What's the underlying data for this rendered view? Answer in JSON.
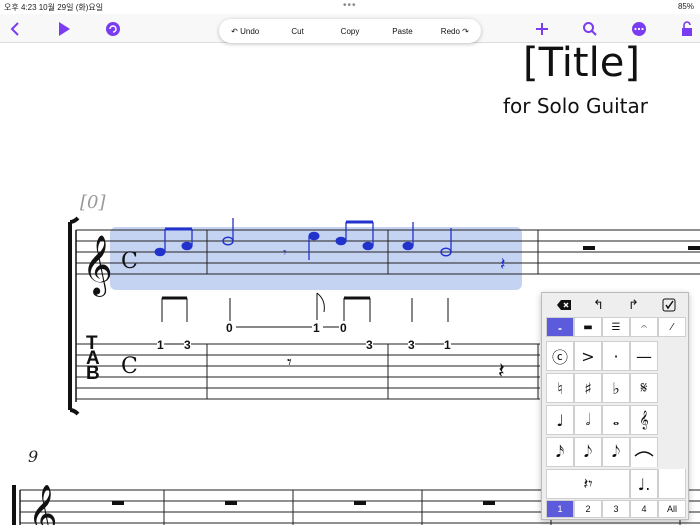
{
  "status": {
    "left": "오후 4:23   10월 29일 (화)요일",
    "right": "85%"
  },
  "toolbar": {
    "back_icon": "chevron-left-icon",
    "play_icon": "play-icon",
    "loop_icon": "loop-icon",
    "add_icon": "plus-icon",
    "search_icon": "search-icon",
    "more_icon": "ellipsis-icon",
    "lock_icon": "lock-icon"
  },
  "edit_menu": {
    "undo": "Undo",
    "cut": "Cut",
    "copy": "Copy",
    "paste": "Paste",
    "redo": "Redo"
  },
  "score": {
    "title": "[Title]",
    "subtitle": "for Solo Guitar",
    "measure_number_1": "[0]",
    "measure_number_2": "9",
    "tab_letters": [
      "T",
      "A",
      "B"
    ],
    "time_signature": "C",
    "tab_numbers": [
      "1",
      "3",
      "0",
      "1",
      "0",
      "3",
      "3",
      "1"
    ]
  },
  "palette": {
    "rows": [
      [
        "ⓒ",
        ">",
        "·",
        "—"
      ],
      [
        "♮",
        "♯",
        "♭",
        "𝄋"
      ],
      [
        "♩",
        "𝅗𝅥",
        "𝅝",
        "𝄞"
      ],
      [
        "𝅘𝅥𝅯",
        "𝅘𝅥𝅮",
        "𝅘𝅥𝅮",
        ""
      ]
    ],
    "numbers": [
      "1",
      "2",
      "3",
      "4",
      "All"
    ],
    "selected_number": "1"
  },
  "colors": {
    "accent": "#7a3cf0",
    "selection": "#b6c8f0",
    "note_blue": "#2233cc",
    "palette_selected": "#5b5bdc"
  }
}
